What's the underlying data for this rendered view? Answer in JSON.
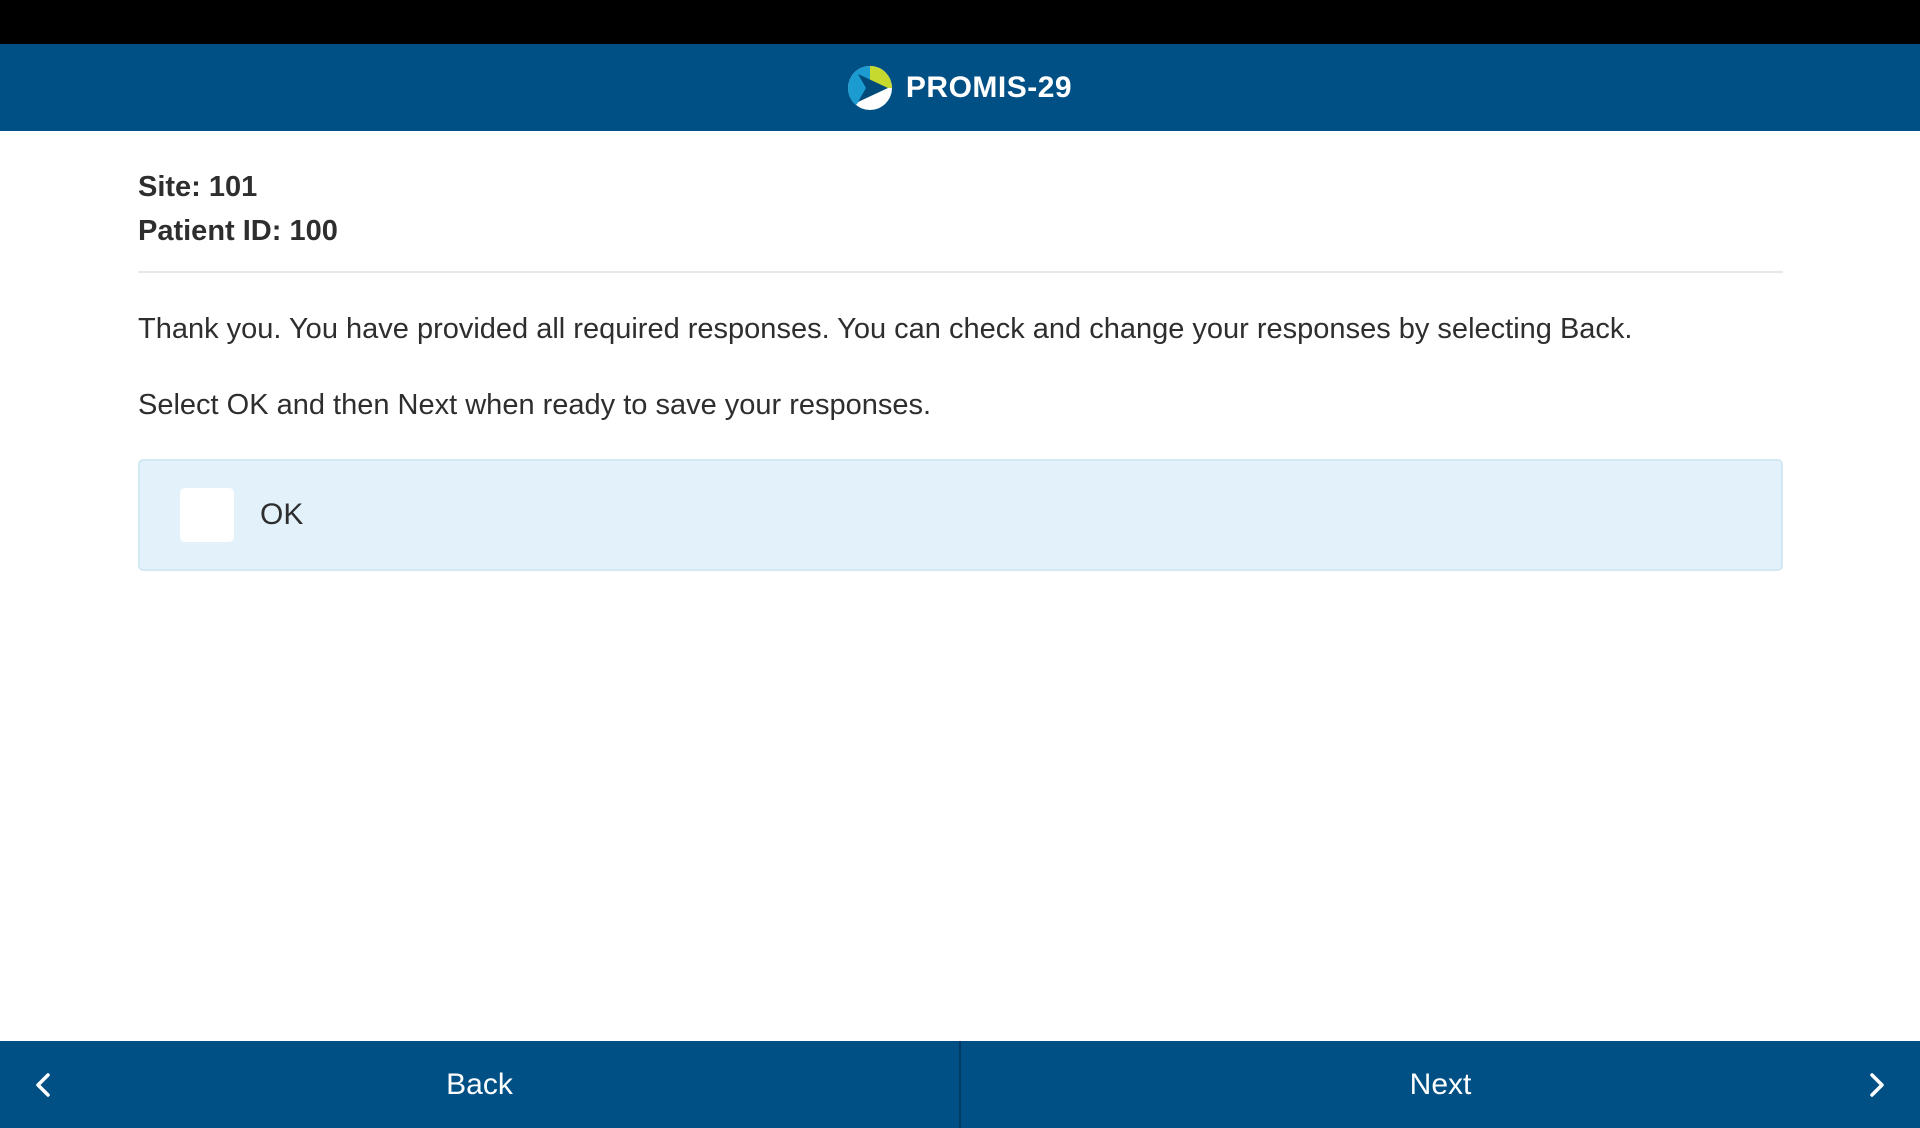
{
  "header": {
    "title": "PROMIS-29",
    "logo_icon": "promis-logo-icon"
  },
  "patient": {
    "site_label": "Site: 101",
    "patient_id_label": "Patient ID: 100"
  },
  "messages": {
    "thank_you": "Thank you. You have provided all required responses. You can check and change your responses by selecting Back.",
    "instruction": "Select OK and then Next when ready to save your responses."
  },
  "ok_option": {
    "label": "OK",
    "checked": false
  },
  "footer": {
    "back_label": "Back",
    "next_label": "Next",
    "back_icon": "chevron-left-icon",
    "next_icon": "chevron-right-icon"
  },
  "colors": {
    "brand_blue": "#015085",
    "option_bg": "#e3f2fa",
    "logo_green": "#c6d92f",
    "logo_teal": "#1b9bd0"
  }
}
